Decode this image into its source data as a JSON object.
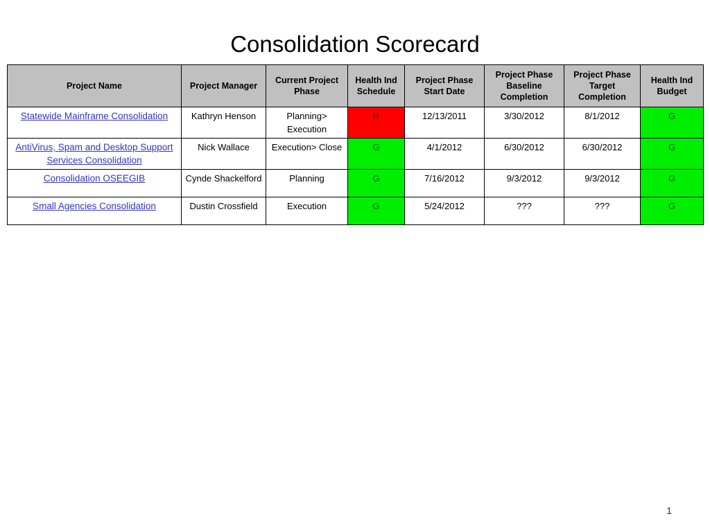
{
  "slide": {
    "title": "Consolidation Scorecard",
    "page_number": "1"
  },
  "colors": {
    "header_bg": "#c0c0c0",
    "link": "#3333cc",
    "health_red_bg": "#ff0000",
    "health_red_text": "#8b0000",
    "health_green_bg": "#00ee00",
    "health_green_text": "#006400",
    "border": "#000000"
  },
  "table": {
    "headers": [
      "Project Name",
      "Project Manager",
      "Current Project Phase",
      "Health Ind Schedule",
      "Project Phase Start Date",
      "Project Phase Baseline Completion",
      "Project Phase Target Completion",
      "Health Ind Budget"
    ],
    "rows": [
      {
        "project_name": "Statewide Mainframe Consolidation",
        "project_manager": "Kathryn Henson",
        "current_phase": "Planning> Execution",
        "health_schedule": "R",
        "health_schedule_status": "red",
        "start_date": "12/13/2011",
        "baseline_completion": "3/30/2012",
        "target_completion": "8/1/2012",
        "health_budget": "G",
        "health_budget_status": "green"
      },
      {
        "project_name": "AntiVirus, Spam and Desktop Support Services Consolidation",
        "project_manager": "Nick Wallace",
        "current_phase": "Execution> Close",
        "health_schedule": "G",
        "health_schedule_status": "green",
        "start_date": "4/1/2012",
        "baseline_completion": "6/30/2012",
        "target_completion": "6/30/2012",
        "health_budget": "G",
        "health_budget_status": "green"
      },
      {
        "project_name": "Consolidation OSEEGIB",
        "project_manager": "Cynde Shackelford",
        "current_phase": "Planning",
        "health_schedule": "G",
        "health_schedule_status": "green",
        "start_date": "7/16/2012",
        "baseline_completion": "9/3/2012",
        "target_completion": "9/3/2012",
        "health_budget": "G",
        "health_budget_status": "green"
      },
      {
        "project_name": "Small Agencies Consolidation",
        "project_manager": "Dustin Crossfield",
        "current_phase": "Execution",
        "health_schedule": "G",
        "health_schedule_status": "green",
        "start_date": "5/24/2012",
        "baseline_completion": "???",
        "target_completion": "???",
        "health_budget": "G",
        "health_budget_status": "green"
      }
    ]
  }
}
